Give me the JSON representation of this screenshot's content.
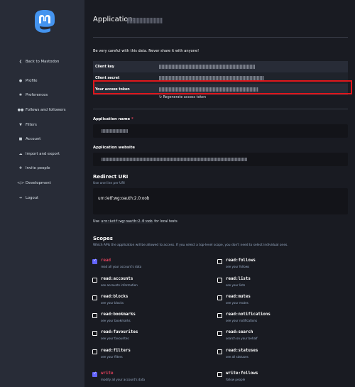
{
  "colors": {
    "sidebar_bg": "#282c37",
    "main_bg": "#191b22",
    "accent": "#6364ff",
    "danger": "#df405a",
    "highlight_box": "#e0171c"
  },
  "sidebar": {
    "logo": "mastodon-logo",
    "items": [
      {
        "label": "Back to Mastodon",
        "icon": "chevron-left-icon"
      },
      {
        "label": "Profile",
        "icon": "user-icon"
      },
      {
        "label": "Preferences",
        "icon": "gear-icon"
      },
      {
        "label": "Follows and followers",
        "icon": "users-icon"
      },
      {
        "label": "Filters",
        "icon": "filter-icon"
      },
      {
        "label": "Account",
        "icon": "lock-icon"
      },
      {
        "label": "Import and export",
        "icon": "cloud-icon"
      },
      {
        "label": "Invite people",
        "icon": "user-plus-icon"
      },
      {
        "label": "Development",
        "icon": "code-icon"
      },
      {
        "label": "Logout",
        "icon": "sign-out-icon"
      }
    ]
  },
  "page": {
    "title": "Application:",
    "warning": "Be very careful with this data. Never share it with anyone!",
    "credentials": [
      {
        "key": "Client key"
      },
      {
        "key": "Client secret"
      },
      {
        "key": "Your access token"
      }
    ],
    "regenerate_label": "Regenerate access token"
  },
  "form": {
    "app_name_label": "Application name",
    "required_mark": "*",
    "website_label": "Application website",
    "redirect_title": "Redirect URI",
    "redirect_hint": "Use one line per URI",
    "redirect_value": "urn:ietf:wg:oauth:2.0:oob",
    "use_prefix": "Use",
    "use_code": "urn:ietf:wg:oauth:2.0:oob",
    "use_suffix": "for local tests",
    "scopes_title": "Scopes",
    "scopes_hint": "Which APIs the application will be allowed to access. If you select a top-level scope, you don't need to select individual ones."
  },
  "scopes": [
    {
      "name": "read",
      "desc": "read all your account's data",
      "checked": true,
      "accent": true
    },
    {
      "name": "read:follows",
      "desc": "see your follows",
      "checked": false
    },
    {
      "name": "read:accounts",
      "desc": "see accounts information",
      "checked": false
    },
    {
      "name": "read:lists",
      "desc": "see your lists",
      "checked": false
    },
    {
      "name": "read:blocks",
      "desc": "see your blocks",
      "checked": false
    },
    {
      "name": "read:mutes",
      "desc": "see your mutes",
      "checked": false
    },
    {
      "name": "read:bookmarks",
      "desc": "see your bookmarks",
      "checked": false
    },
    {
      "name": "read:notifications",
      "desc": "see your notifications",
      "checked": false
    },
    {
      "name": "read:favourites",
      "desc": "see your favourites",
      "checked": false
    },
    {
      "name": "read:search",
      "desc": "search on your behalf",
      "checked": false
    },
    {
      "name": "read:filters",
      "desc": "see your filters",
      "checked": false
    },
    {
      "name": "read:statuses",
      "desc": "see all statuses",
      "checked": false
    },
    {
      "name": "write",
      "desc": "modify all your account's data",
      "checked": true,
      "accent": true
    },
    {
      "name": "write:follows",
      "desc": "follow people",
      "checked": false
    }
  ]
}
